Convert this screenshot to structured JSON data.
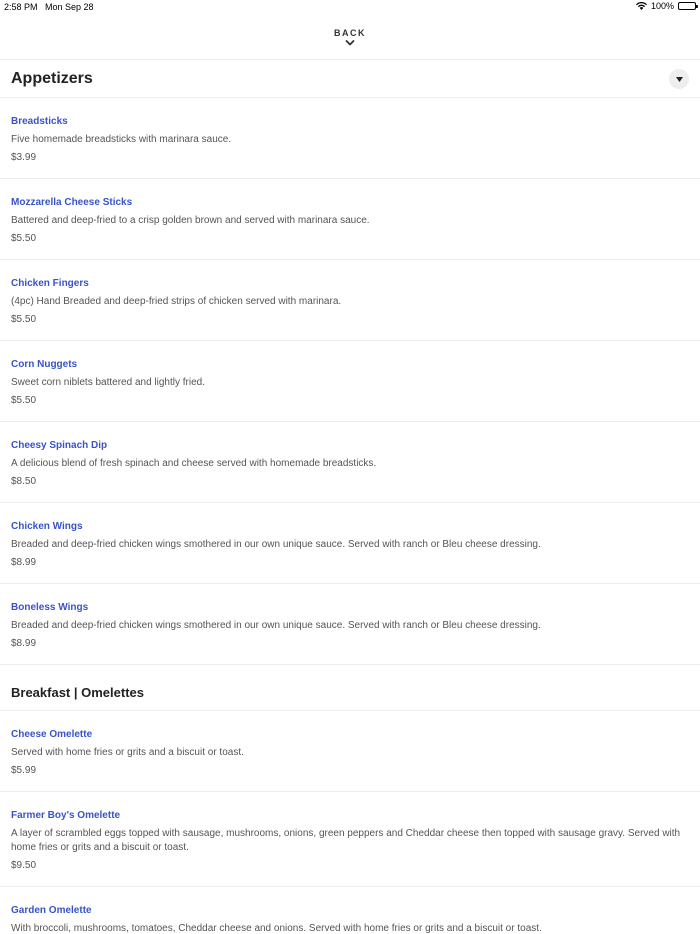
{
  "status_bar": {
    "time": "2:58 PM",
    "date": "Mon Sep 28",
    "battery": "100%",
    "icons": [
      "wifi-icon",
      "battery-icon"
    ]
  },
  "nav": {
    "back_label": "BACK",
    "back_icon": "chevron-down-icon"
  },
  "sections": [
    {
      "title": "Appetizers",
      "collapse_icon": "caret-down-icon",
      "items": [
        {
          "name": "Breadsticks",
          "description": "Five homemade breadsticks with marinara sauce.",
          "price": "$3.99"
        },
        {
          "name": "Mozzarella Cheese Sticks",
          "description": "Battered and deep-fried to a crisp golden brown and served with marinara sauce.",
          "price": "$5.50"
        },
        {
          "name": "Chicken Fingers",
          "description": "(4pc) Hand Breaded and deep-fried strips of chicken served with marinara.",
          "price": "$5.50"
        },
        {
          "name": "Corn Nuggets",
          "description": "Sweet corn niblets battered and lightly fried.",
          "price": "$5.50"
        },
        {
          "name": "Cheesy Spinach Dip",
          "description": "A delicious blend of fresh spinach and cheese served with homemade breadsticks.",
          "price": "$8.50"
        },
        {
          "name": "Chicken Wings",
          "description": "Breaded and deep-fried chicken wings smothered in our own unique sauce. Served with ranch or Bleu cheese dressing.",
          "price": "$8.99"
        },
        {
          "name": "Boneless Wings",
          "description": "Breaded and deep-fried chicken wings smothered in our own unique sauce. Served with ranch or Bleu cheese dressing.",
          "price": "$8.99"
        }
      ]
    },
    {
      "title": "Breakfast | Omelettes",
      "items": [
        {
          "name": "Cheese Omelette",
          "description": "Served with home fries or grits and a biscuit or toast.",
          "price": "$5.99"
        },
        {
          "name": "Farmer Boy's Omelette",
          "description": "A layer of scrambled eggs topped with sausage, mushrooms, onions, green peppers and Cheddar cheese then topped with sausage gravy. Served with home fries or grits and a biscuit or toast.",
          "price": "$9.50"
        },
        {
          "name": "Garden Omelette",
          "description": "With broccoli, mushrooms, tomatoes, Cheddar cheese and onions. Served with home fries or grits and a biscuit or toast.",
          "price": ""
        }
      ]
    }
  ],
  "colors": {
    "item_name": "#3854c8",
    "divider": "#ececec",
    "text": "#555555"
  }
}
